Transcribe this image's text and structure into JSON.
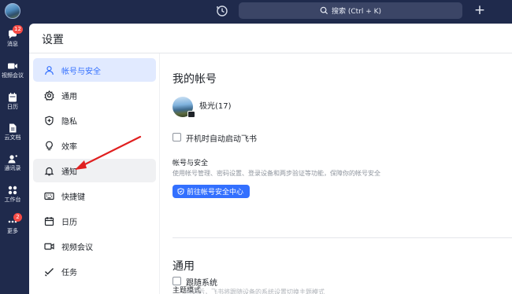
{
  "topbar": {
    "search_placeholder": "搜索 (Ctrl + K)",
    "plus_label": "+"
  },
  "rail": {
    "items": [
      {
        "label": "消息",
        "icon": "chat-bubble-icon",
        "badge": "12"
      },
      {
        "label": "视频会议",
        "icon": "video-camera-icon"
      },
      {
        "label": "日历",
        "icon": "calendar-icon"
      },
      {
        "label": "云文档",
        "icon": "document-icon"
      },
      {
        "label": "通讯录",
        "icon": "contacts-icon"
      },
      {
        "label": "工作台",
        "icon": "grid-apps-icon"
      },
      {
        "label": "更多",
        "icon": "more-dots-icon",
        "badge": "2"
      }
    ]
  },
  "settings": {
    "title": "设置",
    "nav": [
      {
        "label": "帐号与安全",
        "icon": "person-icon",
        "active": true
      },
      {
        "label": "通用",
        "icon": "gear-icon"
      },
      {
        "label": "隐私",
        "icon": "shield-plus-icon"
      },
      {
        "label": "效率",
        "icon": "lightbulb-icon"
      },
      {
        "label": "通知",
        "icon": "bell-icon",
        "hover": true
      },
      {
        "label": "快捷键",
        "icon": "keyboard-icon"
      },
      {
        "label": "日历",
        "icon": "calendar-icon"
      },
      {
        "label": "视频会议",
        "icon": "video-icon"
      },
      {
        "label": "任务",
        "icon": "checkmark-icon"
      }
    ]
  },
  "account": {
    "section_title": "我的帐号",
    "profile_name": "极光(17)",
    "autostart_label": "开机时自动启动飞书",
    "autostart_checked": false,
    "security_heading": "帐号与安全",
    "security_desc": "使用帐号管理、密码设置、登录设备和两步验证等功能，保障你的帐号安全",
    "security_button": "前往帐号安全中心"
  },
  "general": {
    "section_title": "通用",
    "theme_heading": "主题模式",
    "follow_system_label": "跟随系统",
    "follow_system_checked": false,
    "faded_desc": "勾选后，飞书将跟随设备的系统设置切换主题模式"
  },
  "colors": {
    "sidebar_bg": "#1f2a4c",
    "accent": "#3370ff",
    "active_nav_bg": "#e1eaff",
    "annotation_arrow": "#e02020",
    "badge": "#f54a45"
  }
}
